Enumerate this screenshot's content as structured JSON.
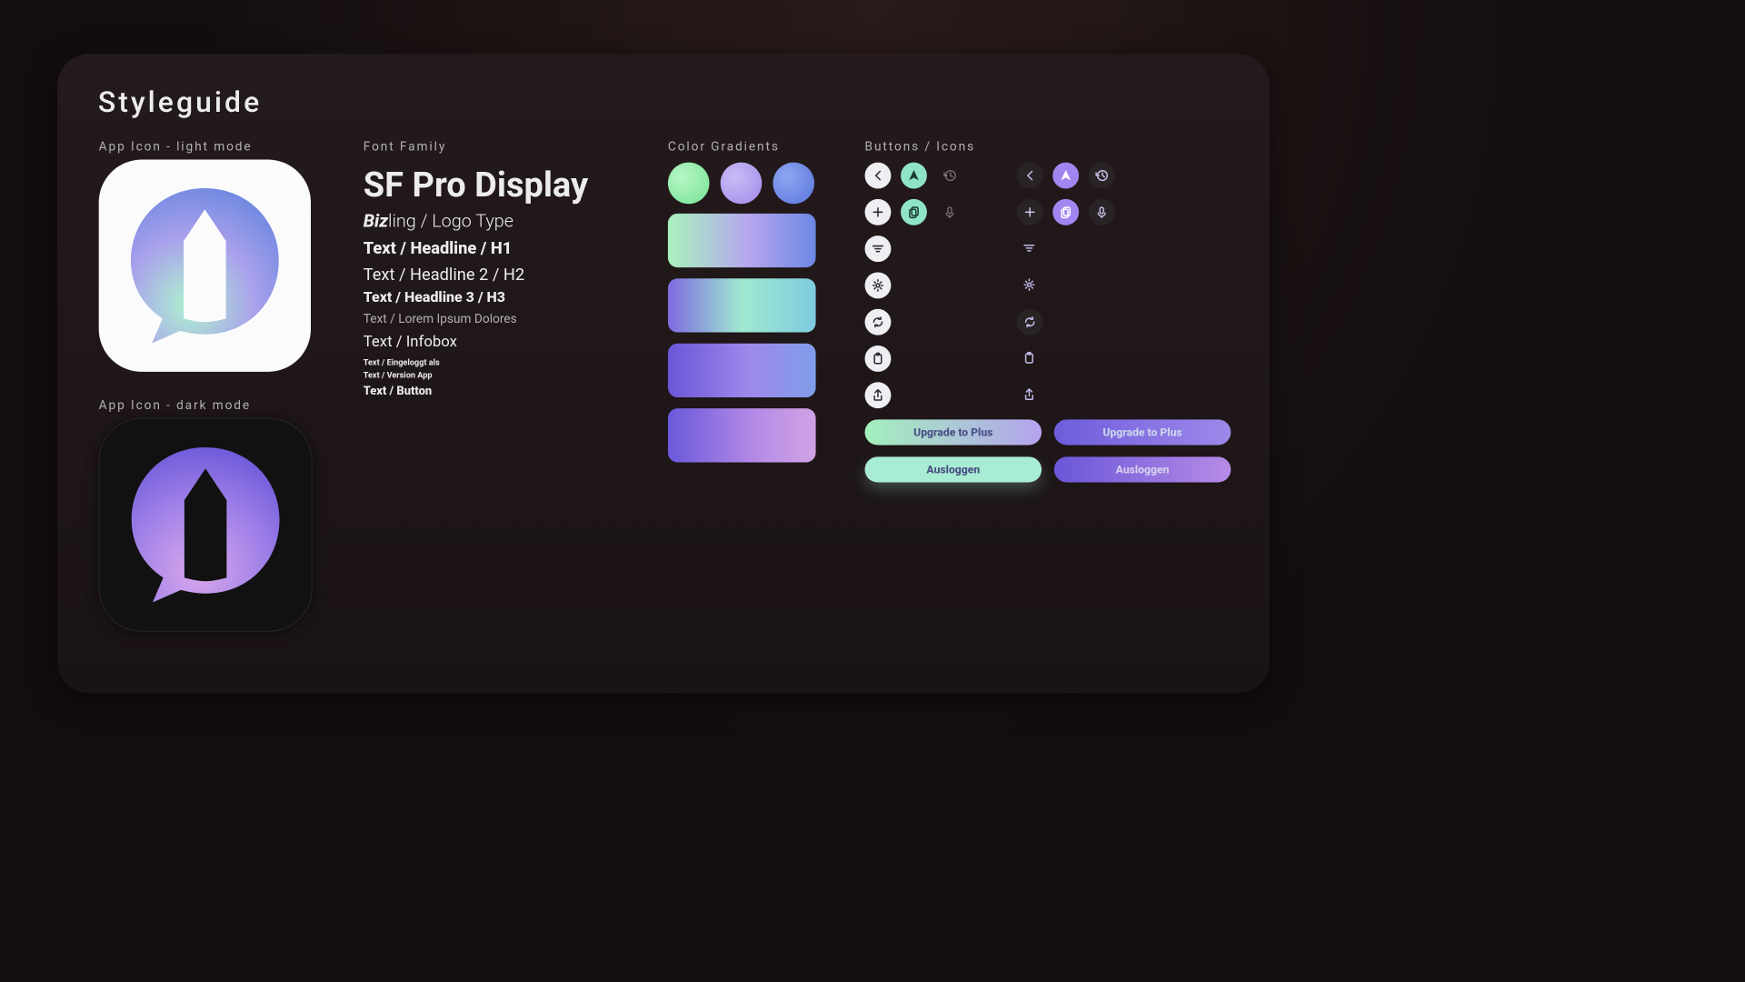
{
  "title": "Styleguide",
  "icons_section": {
    "light_label": "App Icon - light mode",
    "dark_label": "App Icon - dark mode"
  },
  "typography": {
    "section_label": "Font Family",
    "font_name": "SF Pro Display",
    "logo_biz": "Biz",
    "logo_ling": "ling",
    "logo_suffix": " / Logo Type",
    "h1": "Text / Headline / H1",
    "h2": "Text / Headline 2 / H2",
    "h3": "Text / Headline 3 / H3",
    "lorem": "Text / Lorem Ipsum Dolores",
    "infobox": "Text / Infobox",
    "logged_in": "Text / Eingeloggt als",
    "version": "Text / Version App",
    "button": "Text / Button"
  },
  "gradients": {
    "section_label": "Color Gradients",
    "colors": {
      "green": "#9ff2b0",
      "lavender": "#b7a4f0",
      "blue": "#6f8be8"
    }
  },
  "controls": {
    "section_label": "Buttons / Icons",
    "upgrade_label": "Upgrade to Plus",
    "logout_label": "Ausloggen",
    "icon_names": {
      "back": "chevron-left",
      "send": "paper-plane",
      "history": "history",
      "add": "plus",
      "copy": "copy-doc",
      "mic": "microphone",
      "filter": "filter-lines",
      "settings": "gear",
      "refresh": "sync",
      "paste": "clipboard-doc",
      "share": "share-up"
    }
  }
}
